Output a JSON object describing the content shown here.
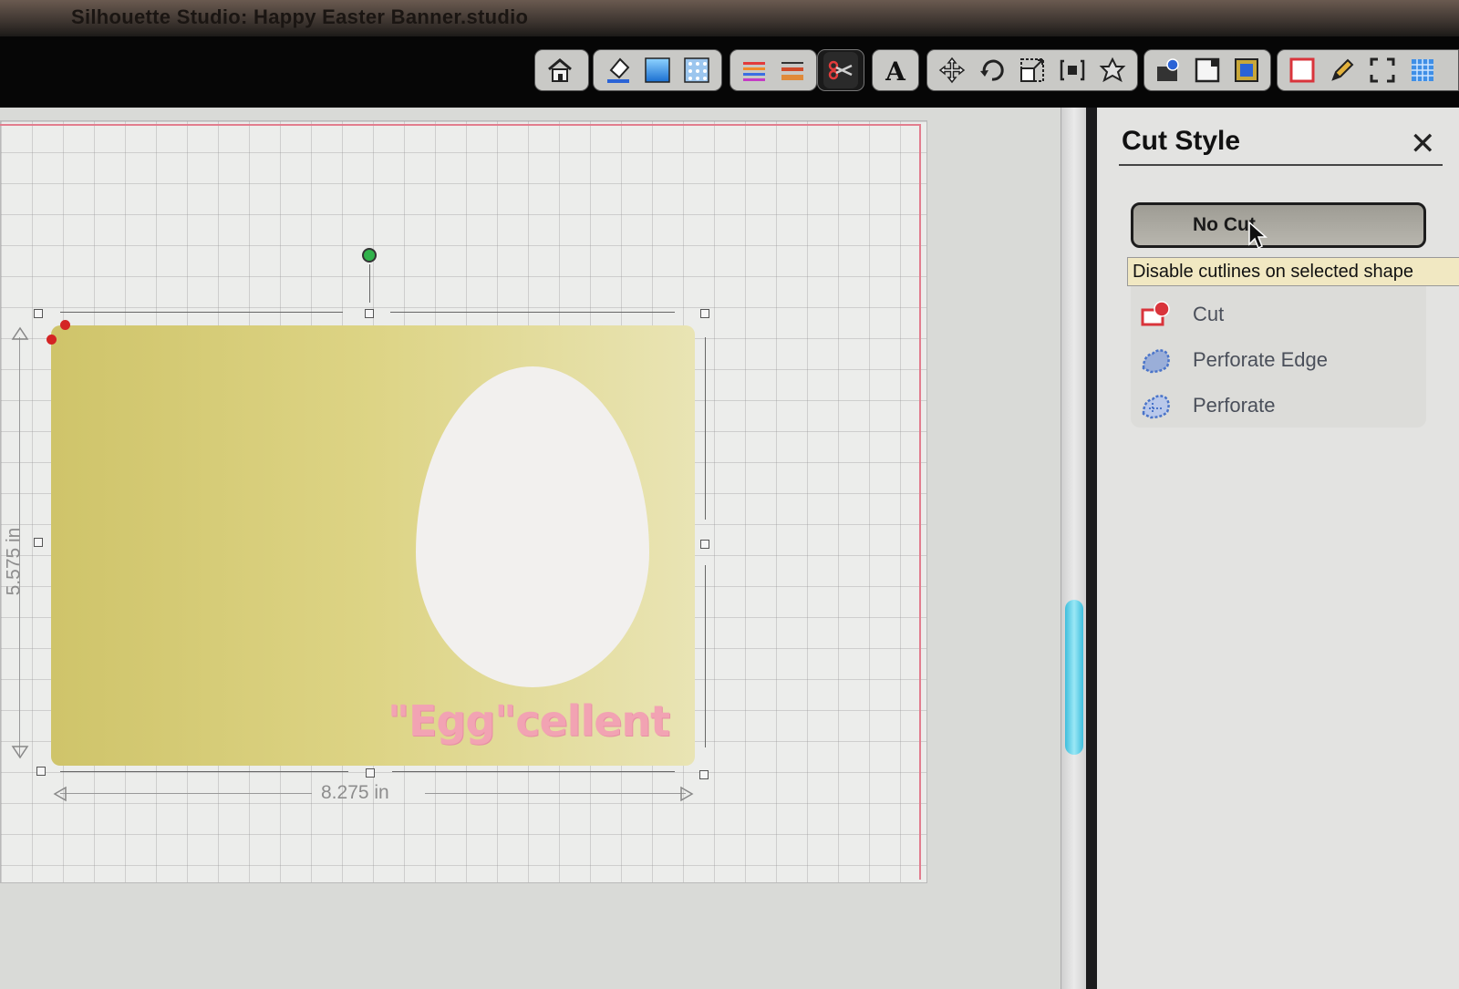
{
  "window": {
    "title": "Silhouette Studio: Happy Easter Banner.studio"
  },
  "toolbar": {
    "groups": [
      {
        "items": [
          "home-icon"
        ]
      },
      {
        "items": [
          "fill-color-icon",
          "fill-gradient-icon",
          "fill-pattern-icon"
        ]
      },
      {
        "items": [
          "line-color-icon",
          "line-style-icon"
        ]
      },
      {
        "items": [
          "cut-style-icon"
        ],
        "active": "cut-style-icon"
      },
      {
        "items": [
          "text-style-icon"
        ]
      },
      {
        "items": [
          "move-icon",
          "rotate-icon",
          "scale-icon",
          "replicate-icon",
          "transform-icon"
        ]
      },
      {
        "items": [
          "library-icon",
          "print-icon",
          "trace-icon"
        ]
      },
      {
        "items": [
          "cut-settings-icon",
          "pencil-icon",
          "fullscreen-icon",
          "grid-icon"
        ]
      }
    ]
  },
  "canvas": {
    "design_text": "\"Egg\"cellent",
    "width_label": "8.275 in",
    "height_label": "5.575 in"
  },
  "panel": {
    "title": "Cut Style",
    "close": "✕",
    "no_cut_label": "No Cut",
    "tooltip": "Disable cutlines on selected shape",
    "options": [
      {
        "label": "Cut",
        "icon": "cut-icon",
        "color": "#d9343b"
      },
      {
        "label": "Perforate Edge",
        "icon": "perforate-edge-icon",
        "color": "#4a74c9"
      },
      {
        "label": "Perforate",
        "icon": "perforate-icon",
        "color": "#4a74c9"
      }
    ]
  },
  "colors": {
    "banner": "#d8cf7b",
    "egg": "#f2f0ee",
    "design_text": "#f2a3b3",
    "cut_line": "#e27d8e",
    "scroll_thumb": "#3fbedc"
  }
}
